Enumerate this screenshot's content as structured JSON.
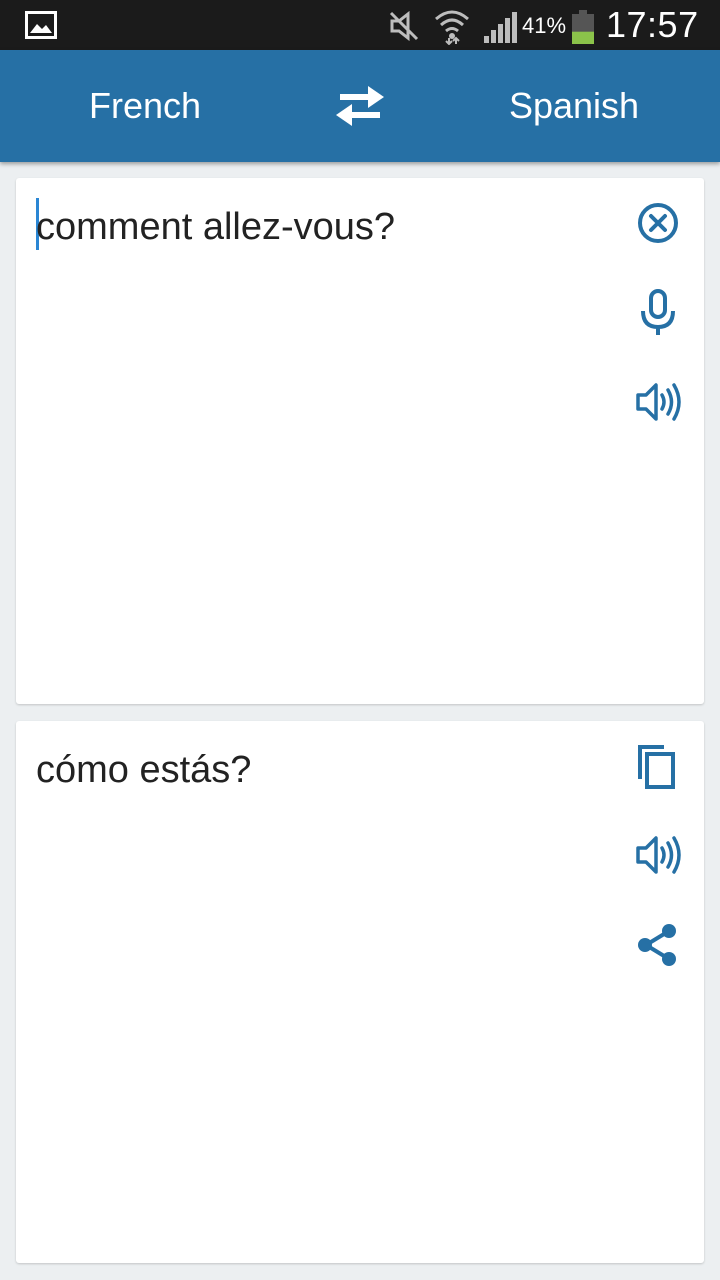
{
  "status_bar": {
    "battery_percent": "41%",
    "clock": "17:57",
    "battery_level": 0.41,
    "icons": [
      "gallery-icon",
      "mute-icon",
      "wifi-icon",
      "signal-icon",
      "battery-icon"
    ]
  },
  "toolbar": {
    "source_language": "French",
    "target_language": "Spanish",
    "swap_icon": "swap-arrows-icon"
  },
  "input_card": {
    "text": "comment allez-vous?",
    "icons": [
      "clear-icon",
      "microphone-icon",
      "speaker-icon"
    ]
  },
  "output_card": {
    "text": "cómo estás?",
    "icons": [
      "copy-icon",
      "speaker-icon",
      "share-icon"
    ]
  },
  "colors": {
    "accent": "#2670a5",
    "status_bar": "#1b1b1b",
    "background": "#eceff1",
    "battery_fill": "#8bc34a"
  }
}
